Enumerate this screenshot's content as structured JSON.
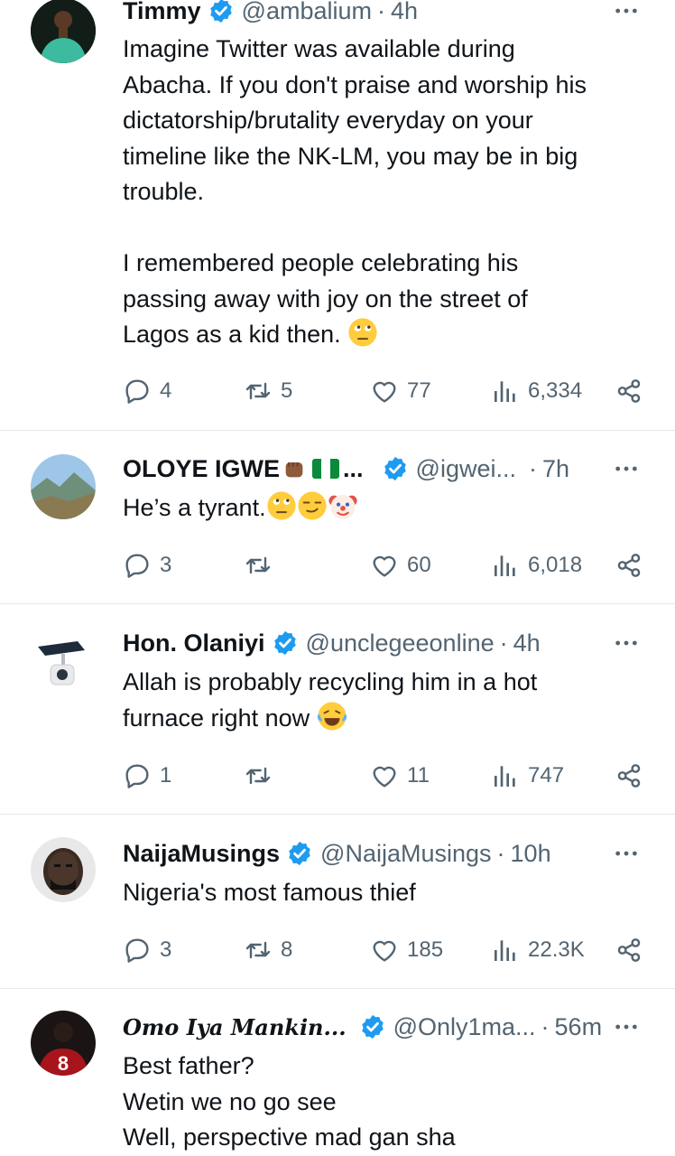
{
  "tweets": [
    {
      "name": "Timmy",
      "handle": "@ambalium",
      "time": "4h",
      "text_lines": [
        "Imagine Twitter was available during",
        "Abacha. If you don't praise and worship his",
        "dictatorship/brutality everyday on your",
        "timeline like the NK-LM, you may be in big",
        "trouble.",
        "",
        "I remembered people celebrating his",
        "passing away with joy on the street of",
        "Lagos as a kid then."
      ],
      "replies": "4",
      "retweets": "5",
      "likes": "77",
      "views": "6,334"
    },
    {
      "name": "OLOYE IGWE",
      "name_suffix": "...",
      "handle": "@igwei...",
      "time": "7h",
      "text": "He’s a tyrant.",
      "replies": "3",
      "retweets": "",
      "likes": "60",
      "views": "6,018"
    },
    {
      "name": "Hon. Olaniyi",
      "handle": "@unclegeeonline",
      "time": "4h",
      "text_lines": [
        "Allah is probably recycling him in a hot",
        "furnace right now"
      ],
      "replies": "1",
      "retweets": "",
      "likes": "11",
      "views": "747"
    },
    {
      "name": "NaijaMusings",
      "handle": "@NaijaMusings",
      "time": "10h",
      "text": "Nigeria's most famous thief",
      "replies": "3",
      "retweets": "8",
      "likes": "185",
      "views": "22.3K"
    },
    {
      "name": "Omo Iya Mankin...",
      "handle": "@Only1ma...",
      "time": "56m",
      "text_lines": [
        "Best father?",
        "Wetin we no go see",
        "Well, perspective mad gan sha"
      ],
      "avatar_text": "8"
    }
  ],
  "colors": {
    "verified": "#1d9bf0",
    "muted": "#536471",
    "text": "#0f1419",
    "divider": "#e6e9ec"
  },
  "icons": [
    "verified-badge-icon",
    "more-icon",
    "reply-icon",
    "retweet-icon",
    "like-icon",
    "views-icon",
    "share-icon"
  ]
}
